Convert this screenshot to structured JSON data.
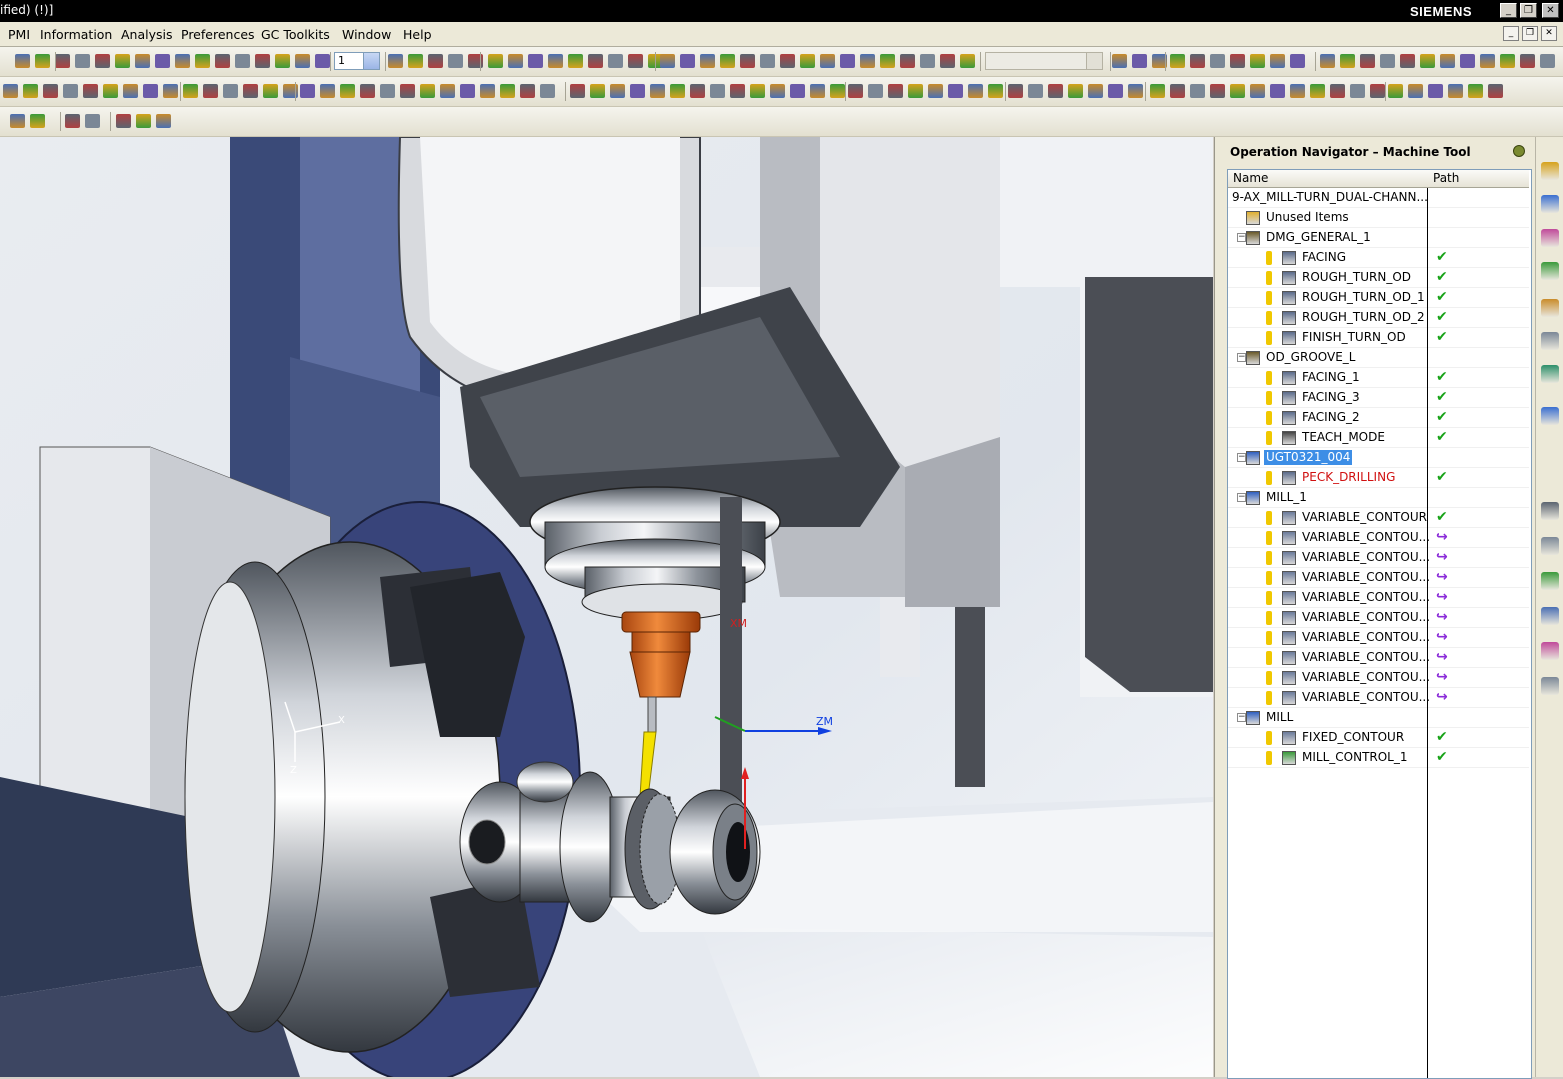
{
  "titlebar": {
    "title": "ified)    (!)]",
    "brand": "SIEMENS",
    "buttons": [
      "_",
      "❐",
      "✕"
    ]
  },
  "menu": {
    "items": [
      "PMI",
      "Information",
      "Analysis",
      "Preferences",
      "GC Toolkits",
      "Window",
      "Help"
    ],
    "right_buttons": [
      "_",
      "❐",
      "✕"
    ]
  },
  "toolbar": {
    "layer_combo_value": "1",
    "filter_combo_value": ""
  },
  "graphics": {
    "csys_labels": {
      "xm": "XM",
      "zm": "ZM",
      "x": "X",
      "z": "Z"
    },
    "colors": {
      "spindle_orange": "#e06a1e",
      "tool_yellow": "#f4e100",
      "axis_red": "#e02020",
      "axis_blue": "#1040e0",
      "axis_green": "#20a020"
    }
  },
  "navigator": {
    "title": "Operation Navigator – Machine Tool",
    "columns": {
      "name": "Name",
      "path": "Path"
    },
    "rows": [
      {
        "label": "9-AX_MILL-TURN_DUAL-CHANN...",
        "level": 0,
        "toggle": "",
        "icon": "machine-root",
        "status": ""
      },
      {
        "label": "Unused Items",
        "level": 1,
        "toggle": "",
        "icon": "folder",
        "status": ""
      },
      {
        "label": "DMG_GENERAL_1",
        "level": 1,
        "toggle": "−",
        "icon": "tool-group",
        "status": ""
      },
      {
        "label": "FACING",
        "level": 2,
        "toggle": "",
        "icon": "turn-op",
        "status": "ok"
      },
      {
        "label": "ROUGH_TURN_OD",
        "level": 2,
        "toggle": "",
        "icon": "turn-op",
        "status": "ok"
      },
      {
        "label": "ROUGH_TURN_OD_1",
        "level": 2,
        "toggle": "",
        "icon": "turn-op",
        "status": "ok"
      },
      {
        "label": "ROUGH_TURN_OD_2",
        "level": 2,
        "toggle": "",
        "icon": "turn-op",
        "status": "ok"
      },
      {
        "label": "FINISH_TURN_OD",
        "level": 2,
        "toggle": "",
        "icon": "turn-op",
        "status": "ok"
      },
      {
        "label": "OD_GROOVE_L",
        "level": 1,
        "toggle": "−",
        "icon": "tool-group",
        "status": ""
      },
      {
        "label": "FACING_1",
        "level": 2,
        "toggle": "",
        "icon": "turn-op",
        "status": "ok"
      },
      {
        "label": "FACING_3",
        "level": 2,
        "toggle": "",
        "icon": "turn-op",
        "status": "ok"
      },
      {
        "label": "FACING_2",
        "level": 2,
        "toggle": "",
        "icon": "turn-op",
        "status": "ok"
      },
      {
        "label": "TEACH_MODE",
        "level": 2,
        "toggle": "",
        "icon": "teach-op",
        "status": "ok"
      },
      {
        "label": "UGT0321_004",
        "level": 1,
        "toggle": "−",
        "icon": "drill-tool",
        "status": "",
        "selected": true
      },
      {
        "label": "PECK_DRILLING",
        "level": 2,
        "toggle": "",
        "icon": "drill-op",
        "status": "ok",
        "red": true
      },
      {
        "label": "MILL_1",
        "level": 1,
        "toggle": "−",
        "icon": "mill-tool",
        "status": ""
      },
      {
        "label": "VARIABLE_CONTOUR",
        "level": 2,
        "toggle": "",
        "icon": "contour-op",
        "status": "ok"
      },
      {
        "label": "VARIABLE_CONTOU...",
        "level": 2,
        "toggle": "",
        "icon": "contour-op",
        "status": "regen"
      },
      {
        "label": "VARIABLE_CONTOU...",
        "level": 2,
        "toggle": "",
        "icon": "contour-op",
        "status": "regen"
      },
      {
        "label": "VARIABLE_CONTOU...",
        "level": 2,
        "toggle": "",
        "icon": "contour-op",
        "status": "regen"
      },
      {
        "label": "VARIABLE_CONTOU...",
        "level": 2,
        "toggle": "",
        "icon": "contour-op",
        "status": "regen"
      },
      {
        "label": "VARIABLE_CONTOU...",
        "level": 2,
        "toggle": "",
        "icon": "contour-op",
        "status": "regen"
      },
      {
        "label": "VARIABLE_CONTOU...",
        "level": 2,
        "toggle": "",
        "icon": "contour-op",
        "status": "regen"
      },
      {
        "label": "VARIABLE_CONTOU...",
        "level": 2,
        "toggle": "",
        "icon": "contour-op",
        "status": "regen"
      },
      {
        "label": "VARIABLE_CONTOU...",
        "level": 2,
        "toggle": "",
        "icon": "contour-op",
        "status": "regen"
      },
      {
        "label": "VARIABLE_CONTOU...",
        "level": 2,
        "toggle": "",
        "icon": "contour-op",
        "status": "regen"
      },
      {
        "label": "MILL",
        "level": 1,
        "toggle": "−",
        "icon": "mill-tool",
        "status": ""
      },
      {
        "label": "FIXED_CONTOUR",
        "level": 2,
        "toggle": "",
        "icon": "contour-op",
        "status": "ok"
      },
      {
        "label": "MILL_CONTROL_1",
        "level": 2,
        "toggle": "",
        "icon": "control-op",
        "status": "ok"
      }
    ],
    "status_glyphs": {
      "ok": "✔",
      "regen": "↪"
    }
  }
}
